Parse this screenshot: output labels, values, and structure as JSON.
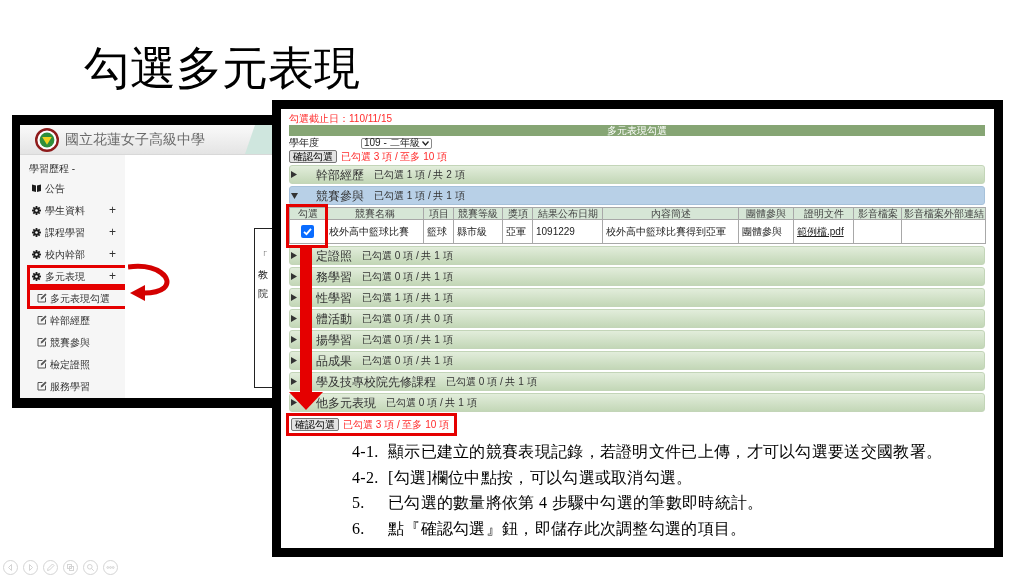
{
  "slide": {
    "title": "勾選多元表現"
  },
  "left_screenshot": {
    "school_name": "國立花蓮女子高級中學",
    "menu_heading": "學習歷程 -",
    "menu": [
      {
        "kind": "page",
        "label": "公告",
        "highlighted": false
      },
      {
        "kind": "group",
        "label": "學生資料",
        "toggle": "+",
        "highlighted": false
      },
      {
        "kind": "group",
        "label": "課程學習",
        "toggle": "+",
        "highlighted": false
      },
      {
        "kind": "group",
        "label": "校內幹部",
        "toggle": "+",
        "highlighted": false
      },
      {
        "kind": "group",
        "label": "多元表現",
        "toggle": "+",
        "highlighted": true
      },
      {
        "kind": "subpage",
        "label": "多元表現勾選",
        "highlighted": true
      },
      {
        "kind": "subpage",
        "label": "幹部經歷",
        "highlighted": false
      },
      {
        "kind": "subpage",
        "label": "競賽參與",
        "highlighted": false
      },
      {
        "kind": "subpage",
        "label": "檢定證照",
        "highlighted": false
      },
      {
        "kind": "subpage",
        "label": "服務學習",
        "highlighted": false
      }
    ],
    "content_lines": [
      "「",
      "教",
      "院"
    ]
  },
  "right_screenshot": {
    "deadline": "勾選截止日：110/11/15",
    "panel_title": "多元表現勾選",
    "year_label": "學年度",
    "year_select": {
      "value": "109 - 二年級"
    },
    "confirm_top": {
      "button": "確認勾選",
      "summary": "已勾選 3 項 / 至多 10 項",
      "highlighted": false
    },
    "sections": [
      {
        "title": "幹部經歷",
        "count": "已勾選 1 項 / 共 2 項",
        "expanded": false
      },
      {
        "title": "競賽參與",
        "count": "已勾選 1 項 / 共 1 項",
        "expanded": true,
        "table": {
          "columns": [
            {
              "label": "勾選",
              "highlighted": true
            },
            {
              "label": "競賽名稱",
              "highlighted": false
            },
            {
              "label": "項目",
              "highlighted": false
            },
            {
              "label": "競賽等級",
              "highlighted": false
            },
            {
              "label": "獎項",
              "highlighted": false
            },
            {
              "label": "結果公布日期",
              "highlighted": false
            },
            {
              "label": "內容簡述",
              "highlighted": false
            },
            {
              "label": "團體參與",
              "highlighted": false
            },
            {
              "label": "證明文件",
              "highlighted": false
            },
            {
              "label": "影音檔案",
              "highlighted": false
            },
            {
              "label": "影音檔案外部連結",
              "highlighted": false
            }
          ],
          "rows": [
            {
              "checked": true,
              "competition": "校外高中籃球比賽",
              "item": "籃球",
              "tier": "縣市級",
              "award": "亞軍",
              "announced": "1091229",
              "summary": "校外高中籃球比賽得到亞軍",
              "team": "團體參與",
              "proof_file": "範例檔.pdf"
            }
          ]
        }
      },
      {
        "title": "定證照",
        "count": "已勾選 0 項 / 共 1 項",
        "expanded": false
      },
      {
        "title": "務學習",
        "count": "已勾選 0 項 / 共 1 項",
        "expanded": false
      },
      {
        "title": "性學習",
        "count": "已勾選 1 項 / 共 1 項",
        "expanded": false
      },
      {
        "title": "體活動",
        "count": "已勾選 0 項 / 共 0 項",
        "expanded": false
      },
      {
        "title": "揚學習",
        "count": "已勾選 0 項 / 共 1 項",
        "expanded": false
      },
      {
        "title": "品成果",
        "count": "已勾選 0 項 / 共 1 項",
        "expanded": false
      },
      {
        "title": "學及技專校院先修課程",
        "count": "已勾選 0 項 / 共 1 項",
        "expanded": false
      },
      {
        "title": "他多元表現",
        "count": "已勾選 0 項 / 共 1 項",
        "expanded": false
      }
    ],
    "confirm_bottom": {
      "button": "確認勾選",
      "summary": "已勾選 3 項 / 至多 10 項",
      "highlighted": true
    }
  },
  "notes": [
    {
      "number": "4-1.",
      "text": "顯示已建立的競賽表現記錄，若證明文件已上傳，才可以勾選要送交國教署。"
    },
    {
      "number": "4-2.",
      "text": "[勾選]欄位中點按，可以勾選或取消勾選。"
    },
    {
      "number": "5.",
      "text": "已勾選的數量將依第 4 步驟中勾選的筆數即時統計。"
    },
    {
      "number": "6.",
      "text": "點『確認勾選』鈕，即儲存此次調整勾選的項目。"
    }
  ]
}
